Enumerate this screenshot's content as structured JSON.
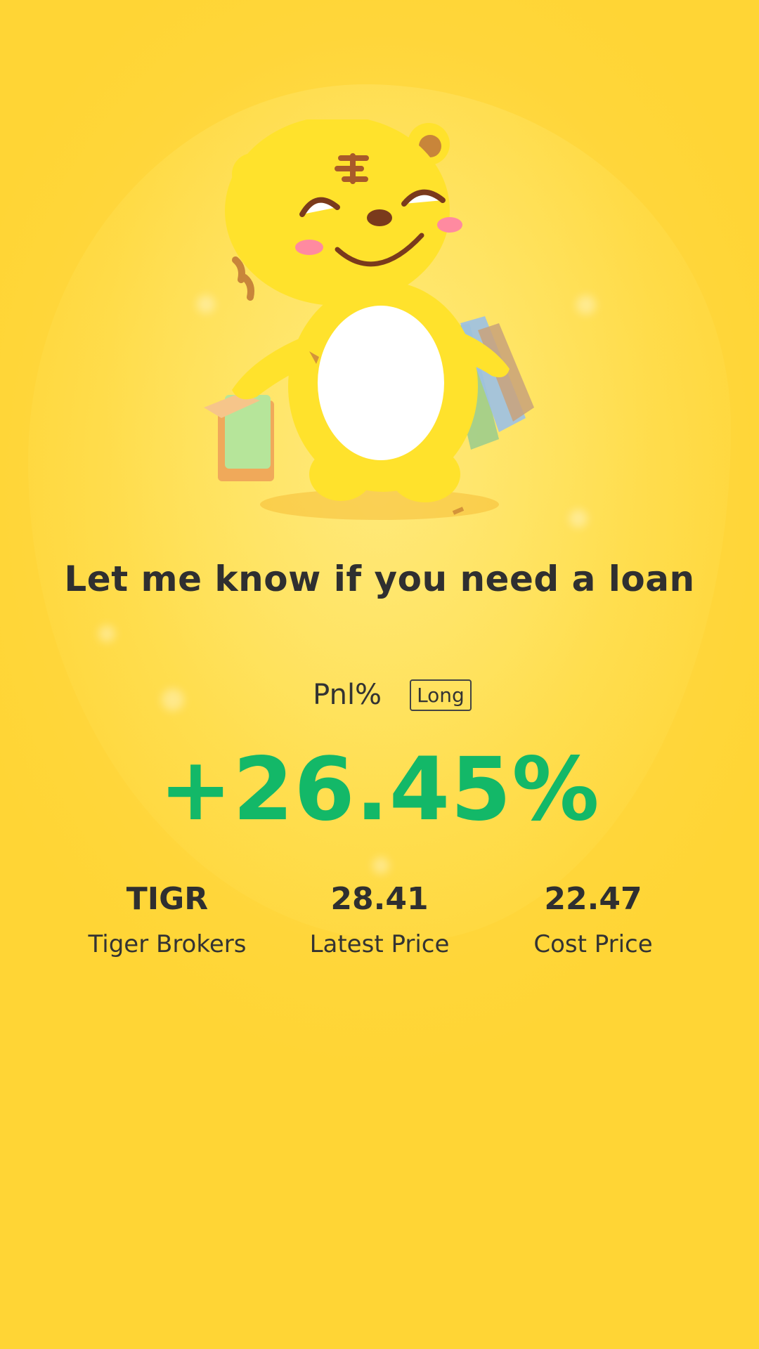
{
  "headline": "Let me know if you need a loan",
  "pnl": {
    "label": "Pnl%",
    "tag": "Long",
    "value": "+26.45%"
  },
  "stats": [
    {
      "value": "TIGR",
      "label": "Tiger Brokers"
    },
    {
      "value": "28.41",
      "label": "Latest Price"
    },
    {
      "value": "22.47",
      "label": "Cost Price"
    }
  ],
  "colors": {
    "background": "#ffd63a",
    "positive": "#13b868",
    "text": "#2f2f30"
  },
  "icons": {
    "mascot": "tiger-mascot-with-shopping-bags"
  }
}
